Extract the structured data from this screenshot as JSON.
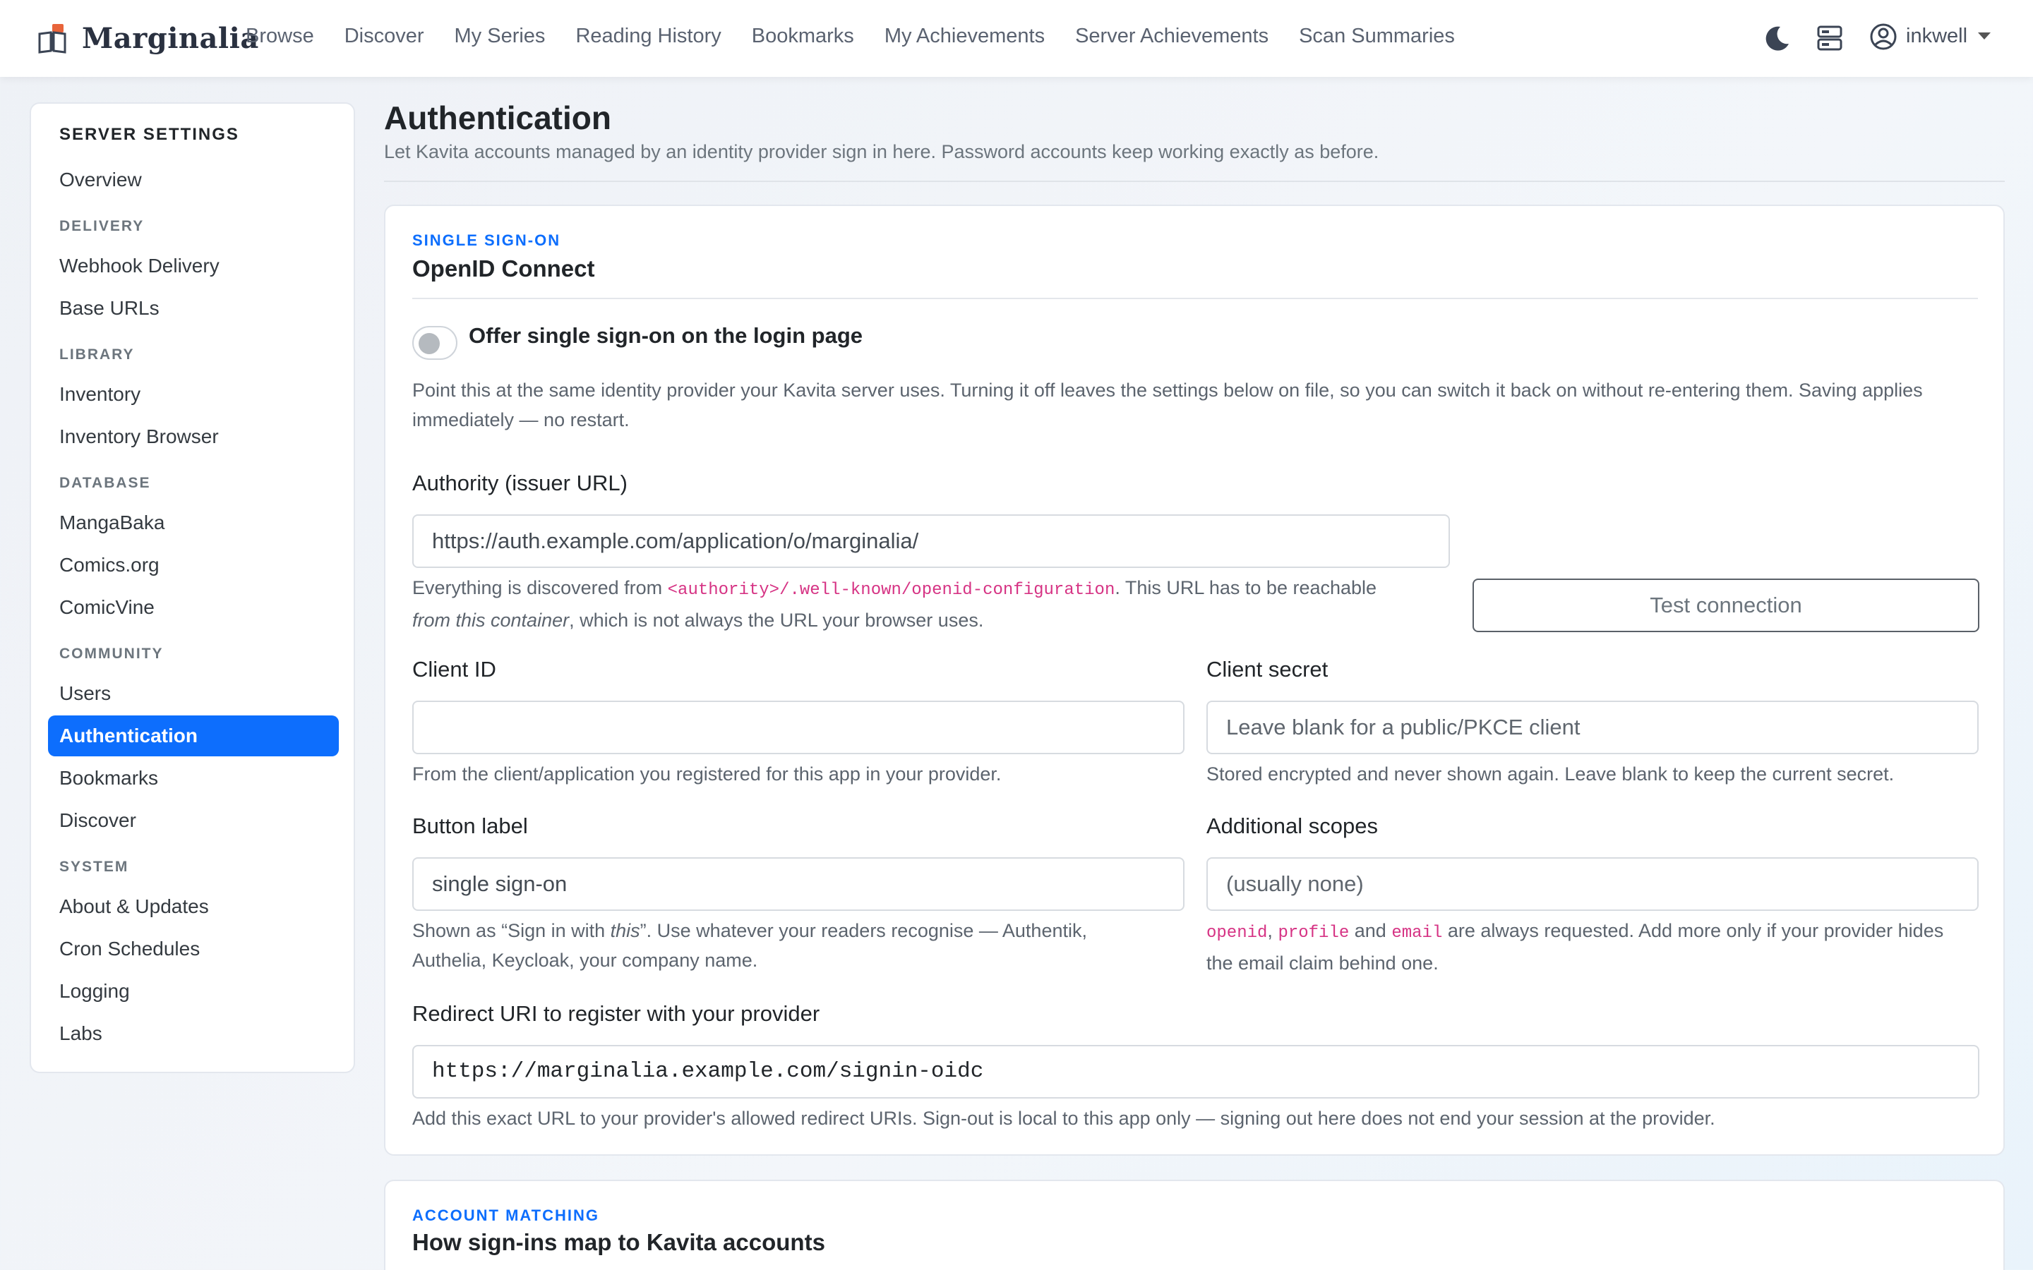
{
  "app": {
    "brand": "Marginalia",
    "user": "inkwell"
  },
  "nav": {
    "links": [
      "Browse",
      "Discover",
      "My Series",
      "Reading History",
      "Bookmarks",
      "My Achievements",
      "Server Achievements",
      "Scan Summaries"
    ]
  },
  "sidebar": {
    "heading": "SERVER SETTINGS",
    "overview": "Overview",
    "sections": {
      "delivery": {
        "label": "DELIVERY",
        "items": [
          "Webhook Delivery",
          "Base URLs"
        ]
      },
      "library": {
        "label": "LIBRARY",
        "items": [
          "Inventory",
          "Inventory Browser"
        ]
      },
      "database": {
        "label": "DATABASE",
        "items": [
          "MangaBaka",
          "Comics.org",
          "ComicVine"
        ]
      },
      "community": {
        "label": "COMMUNITY",
        "items": [
          "Users",
          "Authentication",
          "Bookmarks",
          "Discover"
        ]
      },
      "system": {
        "label": "SYSTEM",
        "items": [
          "About & Updates",
          "Cron Schedules",
          "Logging",
          "Labs"
        ]
      }
    },
    "active": "Authentication"
  },
  "page": {
    "title": "Authentication",
    "subtitle": "Let Kavita accounts managed by an identity provider sign in here. Password accounts keep working exactly as before."
  },
  "oidc_card": {
    "kicker": "SINGLE SIGN-ON",
    "title": "OpenID Connect",
    "toggle_label": "Offer single sign-on on the login page",
    "toggle_on": false,
    "lead": "Point this at the same identity provider your Kavita server uses. Turning it off leaves the settings below on file, so you can switch it back on without re-entering them. Saving applies immediately — no restart.",
    "authority": {
      "label": "Authority (issuer URL)",
      "value": "https://auth.example.com/application/o/marginalia/",
      "help_pre": "Everything is discovered from ",
      "help_code": "<authority>/.well-known/openid-configuration",
      "help_mid": ". This URL has to be reachable ",
      "help_em": "from this container",
      "help_post": ", which is not always the URL your browser uses."
    },
    "test_button": "Test connection",
    "client_id": {
      "label": "Client ID",
      "value": "",
      "help": "From the client/application you registered for this app in your provider."
    },
    "client_secret": {
      "label": "Client secret",
      "placeholder": "Leave blank for a public/PKCE client",
      "help": "Stored encrypted and never shown again. Leave blank to keep the current secret."
    },
    "button_label": {
      "label": "Button label",
      "value": "single sign-on",
      "help_pre": "Shown as “Sign in with ",
      "help_em": "this",
      "help_post": "”. Use whatever your readers recognise — Authentik,",
      "help_line2": "Authelia, Keycloak, your company name."
    },
    "scopes": {
      "label": "Additional scopes",
      "placeholder": "(usually none)",
      "code1": "openid",
      "sep1": ", ",
      "code2": "profile",
      "sep2": " and ",
      "code3": "email",
      "help_post": " are always requested. Add more only if your provider hides",
      "help_line2": "the email claim behind one."
    },
    "redirect": {
      "label": "Redirect URI to register with your provider",
      "value": "https://marginalia.example.com/signin-oidc",
      "help": "Add this exact URL to your provider's allowed redirect URIs. Sign-out is local to this app only — signing out here does not end your session at the provider."
    }
  },
  "matching_card": {
    "kicker": "ACCOUNT MATCHING",
    "title": "How sign-ins map to Kavita accounts"
  },
  "icons": {
    "brand": "book-icon",
    "theme": "moon-icon",
    "server": "server-icon",
    "user": "user-circle-icon",
    "menu": "chevron-down-icon"
  },
  "colors": {
    "accent": "#0d6efd",
    "code": "#d63384"
  }
}
